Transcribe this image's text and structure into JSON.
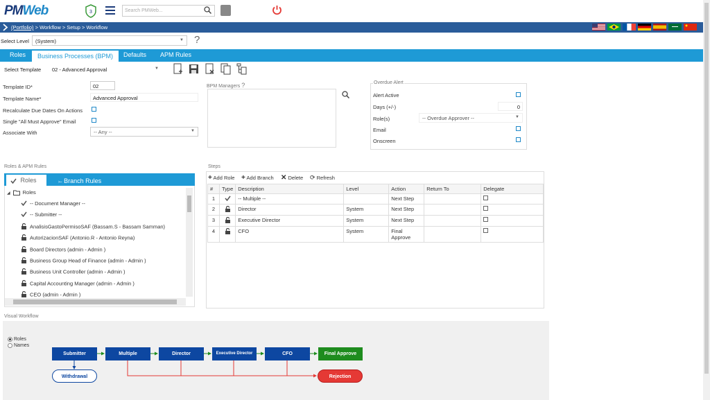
{
  "header": {
    "logo_pm": "PM",
    "logo_web": "Web",
    "shield_count": "3",
    "search_placeholder": "Search PMWeb..."
  },
  "breadcrumb": {
    "portfolio": "(Portfolio)",
    "rest": " > Workflow > Setup > Workflow"
  },
  "flags": [
    "US",
    "BR",
    "FR",
    "DE",
    "ES",
    "SA",
    "CN"
  ],
  "level": {
    "label": "Select Level",
    "value": "(System)"
  },
  "tabs": [
    {
      "label": "Roles",
      "active": false
    },
    {
      "label": "Business Processes (BPM)",
      "active": true
    },
    {
      "label": "Defaults",
      "active": false
    },
    {
      "label": "APM Rules",
      "active": false
    }
  ],
  "template": {
    "label": "Select Template",
    "value": "02 - Advanced Approval"
  },
  "form": {
    "template_id_label": "Template ID*",
    "template_id_value": "02",
    "template_name_label": "Template Name*",
    "template_name_value": "Advanced Approval",
    "recalc_label": "Recalculate Due Dates On Actions",
    "single_label": "Single \"All Must Approve\" Email",
    "associate_label": "Associate With",
    "associate_value": "-- Any --"
  },
  "bpm_managers": {
    "title": "BPM Managers"
  },
  "overdue": {
    "title": "Overdue Alert",
    "alert_active": "Alert Active",
    "days_label": "Days (+/-)",
    "days_value": "0",
    "roles_label": "Role(s)",
    "roles_value": "-- Overdue Approver --",
    "email": "Email",
    "onscreen": "Onscreen"
  },
  "roles_panel": {
    "title": "Roles & APM Rules",
    "tab_roles": "Roles",
    "tab_branch": "Branch Rules",
    "root": "Roles",
    "items": [
      {
        "label": "-- Document Manager --",
        "icon": "check"
      },
      {
        "label": "-- Submitter --",
        "icon": "check"
      },
      {
        "label": "AnalisisGastoPermisoSAF (Bassam.S - Bassam Samman)",
        "icon": "lock"
      },
      {
        "label": "AutorizacionSAF (Antonio.R - Antonio Reyna)",
        "icon": "lock"
      },
      {
        "label": "Board Directors (admin - Admin )",
        "icon": "lock"
      },
      {
        "label": "Business Group Head of Finance (admin - Admin )",
        "icon": "lock"
      },
      {
        "label": "Business Unit Controller (admin - Admin )",
        "icon": "lock"
      },
      {
        "label": "Capital Accounting Manager (admin - Admin )",
        "icon": "lock"
      },
      {
        "label": "CEO (admin - Admin )",
        "icon": "lock"
      }
    ]
  },
  "steps": {
    "title": "Steps",
    "add_role": "Add Role",
    "add_branch": "Add Branch",
    "delete": "Delete",
    "refresh": "Refresh",
    "columns": [
      "#",
      "Type",
      "Description",
      "Level",
      "Action",
      "Return To",
      "Delegate"
    ],
    "rows": [
      {
        "n": "1",
        "type": "check",
        "desc": "-- Multiple --",
        "level": "",
        "action": "Next Step",
        "return": ""
      },
      {
        "n": "2",
        "type": "lock",
        "desc": "Director",
        "level": "System",
        "action": "Next Step",
        "return": ""
      },
      {
        "n": "3",
        "type": "lock",
        "desc": "Executive Director",
        "level": "System",
        "action": "Next Step",
        "return": ""
      },
      {
        "n": "4",
        "type": "lock",
        "desc": "CFO",
        "level": "System",
        "action": "Final Approve",
        "return": ""
      }
    ]
  },
  "visual": {
    "title": "Visual Workflow",
    "opt_roles": "Roles",
    "opt_names": "Names",
    "nodes": {
      "submitter": "Submitter",
      "withdrawal": "Withdrawal",
      "multiple": "Multiple",
      "director": "Director",
      "exec": "Executive Director",
      "cfo": "CFO",
      "final": "Final Approve",
      "rejection": "Rejection"
    }
  },
  "colors": {
    "navy": "#0d47a1",
    "tab_blue": "#1e9ad6",
    "bread_blue": "#2a5c9a",
    "green": "#1e8c1e",
    "red": "#e53935"
  }
}
